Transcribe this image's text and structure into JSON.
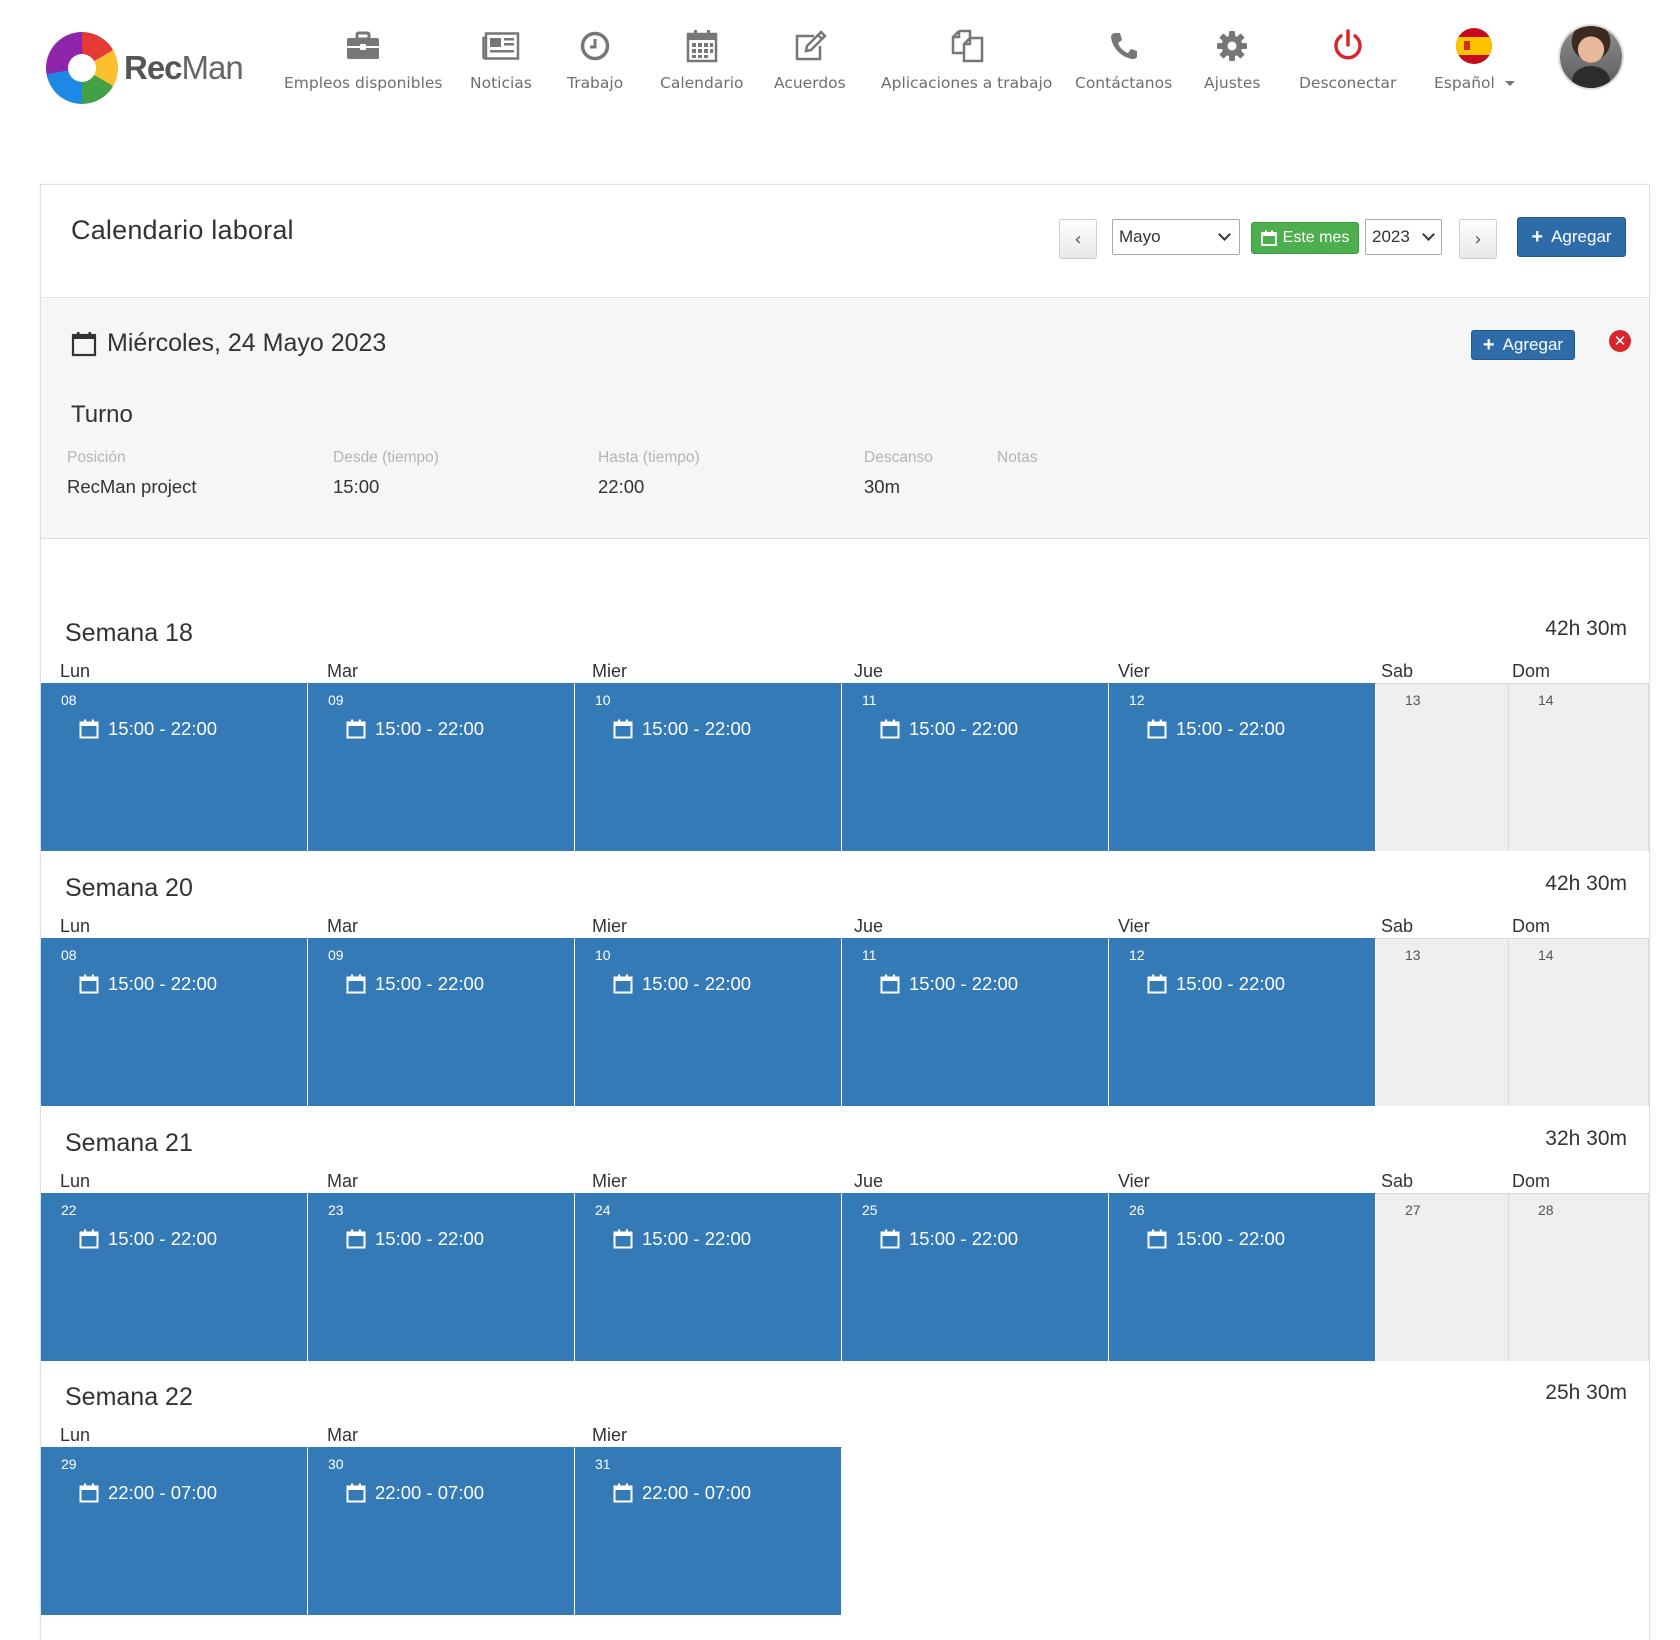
{
  "brand": {
    "rec": "Rec",
    "man": "Man"
  },
  "nav": [
    {
      "label": "Empleos disponibles",
      "icon": "briefcase-icon"
    },
    {
      "label": "Noticias",
      "icon": "newspaper-icon"
    },
    {
      "label": "Trabajo",
      "icon": "clock-icon"
    },
    {
      "label": "Calendario",
      "icon": "calendar-icon"
    },
    {
      "label": "Acuerdos",
      "icon": "edit-icon"
    },
    {
      "label": "Aplicaciones a trabajo",
      "icon": "copy-icon"
    },
    {
      "label": "Contáctanos",
      "icon": "phone-icon"
    },
    {
      "label": "Ajustes",
      "icon": "gear-icon"
    },
    {
      "label": "Desconectar",
      "icon": "power-icon"
    },
    {
      "label": "Español",
      "icon": "spain-flag-icon"
    }
  ],
  "colors": {
    "primary": "#337ab7",
    "success": "#4cae4c",
    "danger": "#d9262c",
    "off_day": "#efefef"
  },
  "calendar": {
    "title": "Calendario laboral",
    "month": "Mayo",
    "this_month_label": "Este mes",
    "year": "2023",
    "add_label": "Agregar",
    "prev": "‹",
    "next": "›"
  },
  "day_detail": {
    "date": "Miércoles, 24 Mayo 2023",
    "add_label": "Agregar",
    "close": "✕",
    "section": "Turno",
    "fields": [
      {
        "label": "Posición",
        "value": "RecMan project"
      },
      {
        "label": "Desde (tiempo)",
        "value": "15:00"
      },
      {
        "label": "Hasta (tiempo)",
        "value": "22:00"
      },
      {
        "label": "Descanso",
        "value": "30m"
      },
      {
        "label": "Notas",
        "value": ""
      }
    ]
  },
  "day_names": [
    "Lun",
    "Mar",
    "Mier",
    "Jue",
    "Vier",
    "Sab",
    "Dom"
  ],
  "weeks": [
    {
      "title": "Semana 18",
      "total": "42h 30m",
      "days": [
        {
          "num": "08",
          "shift": "15:00 - 22:00"
        },
        {
          "num": "09",
          "shift": "15:00 - 22:00"
        },
        {
          "num": "10",
          "shift": "15:00 - 22:00"
        },
        {
          "num": "11",
          "shift": "15:00 - 22:00"
        },
        {
          "num": "12",
          "shift": "15:00 - 22:00"
        },
        {
          "num": "13",
          "shift": ""
        },
        {
          "num": "14",
          "shift": ""
        }
      ]
    },
    {
      "title": "Semana 20",
      "total": "42h 30m",
      "days": [
        {
          "num": "08",
          "shift": "15:00 - 22:00"
        },
        {
          "num": "09",
          "shift": "15:00 - 22:00"
        },
        {
          "num": "10",
          "shift": "15:00 - 22:00"
        },
        {
          "num": "11",
          "shift": "15:00 - 22:00"
        },
        {
          "num": "12",
          "shift": "15:00 - 22:00"
        },
        {
          "num": "13",
          "shift": ""
        },
        {
          "num": "14",
          "shift": ""
        }
      ]
    },
    {
      "title": "Semana 21",
      "total": "32h 30m",
      "days": [
        {
          "num": "22",
          "shift": "15:00 - 22:00"
        },
        {
          "num": "23",
          "shift": "15:00 - 22:00"
        },
        {
          "num": "24",
          "shift": "15:00 - 22:00"
        },
        {
          "num": "25",
          "shift": "15:00 - 22:00"
        },
        {
          "num": "26",
          "shift": "15:00 - 22:00"
        },
        {
          "num": "27",
          "shift": ""
        },
        {
          "num": "28",
          "shift": ""
        }
      ]
    },
    {
      "title": "Semana 22",
      "total": "25h 30m",
      "days": [
        {
          "num": "29",
          "shift": "22:00 - 07:00"
        },
        {
          "num": "30",
          "shift": "22:00 - 07:00"
        },
        {
          "num": "31",
          "shift": "22:00 - 07:00"
        }
      ]
    }
  ]
}
